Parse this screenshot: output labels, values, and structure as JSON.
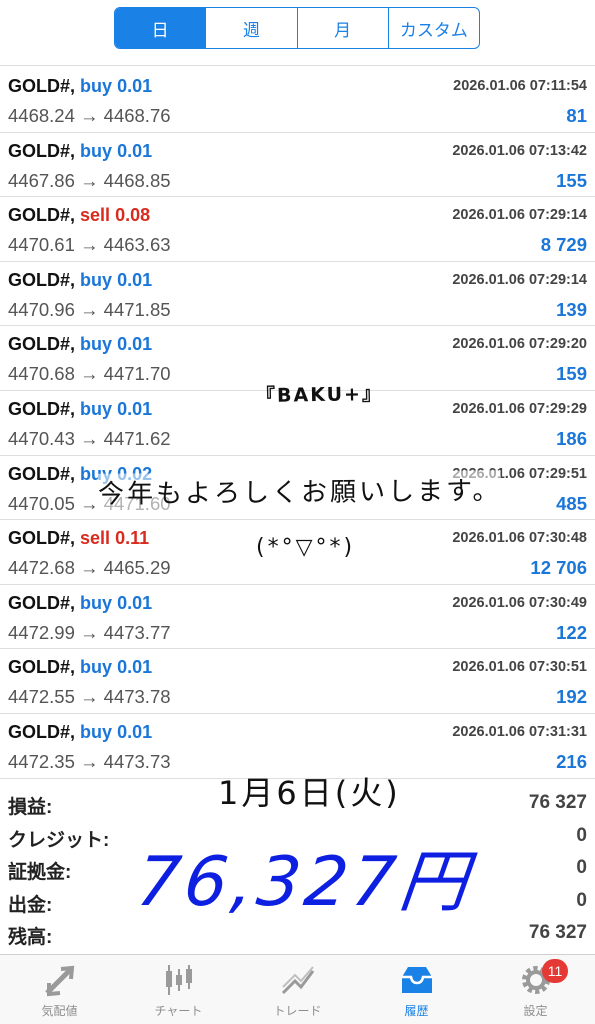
{
  "segments": [
    "日",
    "週",
    "月",
    "カスタム"
  ],
  "trades": [
    {
      "symbol": "GOLD#,",
      "side": "buy",
      "volume": "0.01",
      "time": "2026.01.06 07:11:54",
      "open": "4468.24",
      "close": "4468.76",
      "profit": "81"
    },
    {
      "symbol": "GOLD#,",
      "side": "buy",
      "volume": "0.01",
      "time": "2026.01.06 07:13:42",
      "open": "4467.86",
      "close": "4468.85",
      "profit": "155"
    },
    {
      "symbol": "GOLD#,",
      "side": "sell",
      "volume": "0.08",
      "time": "2026.01.06 07:29:14",
      "open": "4470.61",
      "close": "4463.63",
      "profit": "8 729"
    },
    {
      "symbol": "GOLD#,",
      "side": "buy",
      "volume": "0.01",
      "time": "2026.01.06 07:29:14",
      "open": "4470.96",
      "close": "4471.85",
      "profit": "139"
    },
    {
      "symbol": "GOLD#,",
      "side": "buy",
      "volume": "0.01",
      "time": "2026.01.06 07:29:20",
      "open": "4470.68",
      "close": "4471.70",
      "profit": "159"
    },
    {
      "symbol": "GOLD#,",
      "side": "buy",
      "volume": "0.01",
      "time": "2026.01.06 07:29:29",
      "open": "4470.43",
      "close": "4471.62",
      "profit": "186"
    },
    {
      "symbol": "GOLD#,",
      "side": "buy",
      "volume": "0.02",
      "time": "2026.01.06 07:29:51",
      "open": "4470.05",
      "close": "4471.60",
      "profit": "485"
    },
    {
      "symbol": "GOLD#,",
      "side": "sell",
      "volume": "0.11",
      "time": "2026.01.06 07:30:48",
      "open": "4472.68",
      "close": "4465.29",
      "profit": "12 706"
    },
    {
      "symbol": "GOLD#,",
      "side": "buy",
      "volume": "0.01",
      "time": "2026.01.06 07:30:49",
      "open": "4472.99",
      "close": "4473.77",
      "profit": "122"
    },
    {
      "symbol": "GOLD#,",
      "side": "buy",
      "volume": "0.01",
      "time": "2026.01.06 07:30:51",
      "open": "4472.55",
      "close": "4473.78",
      "profit": "192"
    },
    {
      "symbol": "GOLD#,",
      "side": "buy",
      "volume": "0.01",
      "time": "2026.01.06 07:31:31",
      "open": "4472.35",
      "close": "4473.73",
      "profit": "216"
    }
  ],
  "arrow": "→",
  "summary": [
    {
      "label": "損益:",
      "value": "76 327"
    },
    {
      "label": "クレジット:",
      "value": "0"
    },
    {
      "label": "証拠金:",
      "value": "0"
    },
    {
      "label": "出金:",
      "value": "0"
    },
    {
      "label": "残高:",
      "value": "76 327"
    }
  ],
  "handwriting": {
    "title": "『BAKU+』",
    "greeting": "今年もよろしくお願いします。",
    "face": "(*°▽°*)",
    "date": "1月6日(火)",
    "amount": "76,327円"
  },
  "tabs": [
    {
      "label": "気配値",
      "icon": "quotes-icon"
    },
    {
      "label": "チャート",
      "icon": "chart-icon"
    },
    {
      "label": "トレード",
      "icon": "trade-icon"
    },
    {
      "label": "履歴",
      "icon": "history-icon",
      "active": true
    },
    {
      "label": "設定",
      "icon": "settings-icon",
      "badge": "11"
    }
  ],
  "colors": {
    "accent": "#1a82e6",
    "buy": "#1a76d8",
    "sell": "#d92b1d",
    "badge": "#e53935",
    "handwriting_amount": "#0d1fe0"
  }
}
